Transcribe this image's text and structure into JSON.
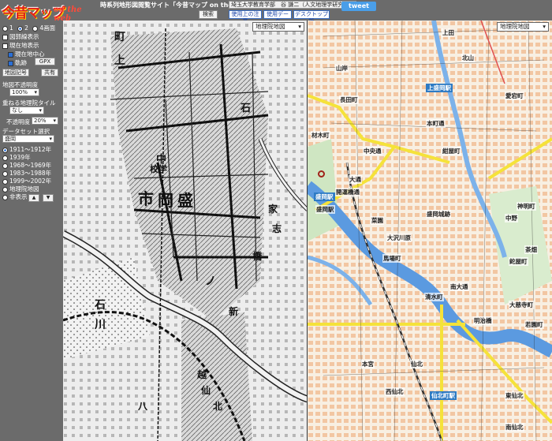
{
  "header": {
    "logo_main": "今昔マップ",
    "logo_sub": "on the web",
    "subtitle": "時系列地形図閲覧サイト「今昔マップ on the web」",
    "affiliation": "埼玉大学教育学部　谷 謙二（人文地理学研究室）",
    "search_label": "検索",
    "links": [
      "使用上の注意",
      "使用データ",
      "デスクトップ版"
    ],
    "tweet_label": "tweet"
  },
  "panel": {
    "screen_options": [
      "1",
      "2",
      "4画面"
    ],
    "screen_selected": "2",
    "grid_label": "図郭線表示",
    "current_label": "現在地表示",
    "current_center_label": "現在地中心",
    "track_label": "軌跡",
    "gpx_label": "GPX",
    "map_symbols_label": "地図記号",
    "share_label": "共有",
    "opacity_label": "地図不透明度",
    "opacity_value": "100%",
    "overlay_tile_label": "重ねる地理院タイル",
    "overlay_value": "なし",
    "overlay_opacity_label": "不透明度",
    "overlay_opacity_value": "20%",
    "dataset_label": "データセット選択",
    "dataset_value": "盛岡",
    "periods": [
      "1911〜1912年",
      "1939年",
      "1968〜1969年",
      "1983〜1988年",
      "1999〜2002年",
      "地理院地図",
      "非表示"
    ],
    "period_selected": "1911〜1912年",
    "up_arrow": "▲",
    "down_arrow": "▼"
  },
  "maps": {
    "left_select": "地理院地図",
    "right_select": "地理院地図",
    "old_labels": [
      "市",
      "岡",
      "盛",
      "校学",
      "中",
      "石",
      "川",
      "八",
      "上",
      "町",
      "ノ",
      "橋",
      "家",
      "志",
      "越",
      "仙",
      "北",
      "新",
      "石"
    ],
    "new_labels": [
      "盛岡駅",
      "大通",
      "盛岡城跡",
      "中央通",
      "本町通",
      "菜園",
      "大沢川原",
      "仙北",
      "南大通",
      "中野",
      "愛宕町",
      "北山",
      "長田町",
      "開運橋通",
      "馬場町",
      "明治橋",
      "神明町",
      "茶畑",
      "若園町",
      "材木町",
      "紺屋町",
      "清水町",
      "本宮",
      "西仙北",
      "東仙北",
      "上田",
      "山岸",
      "大慈寺町",
      "鉈屋町",
      "南仙北"
    ],
    "stations": [
      "上盛岡駅",
      "盛岡駅",
      "仙北町駅"
    ]
  }
}
